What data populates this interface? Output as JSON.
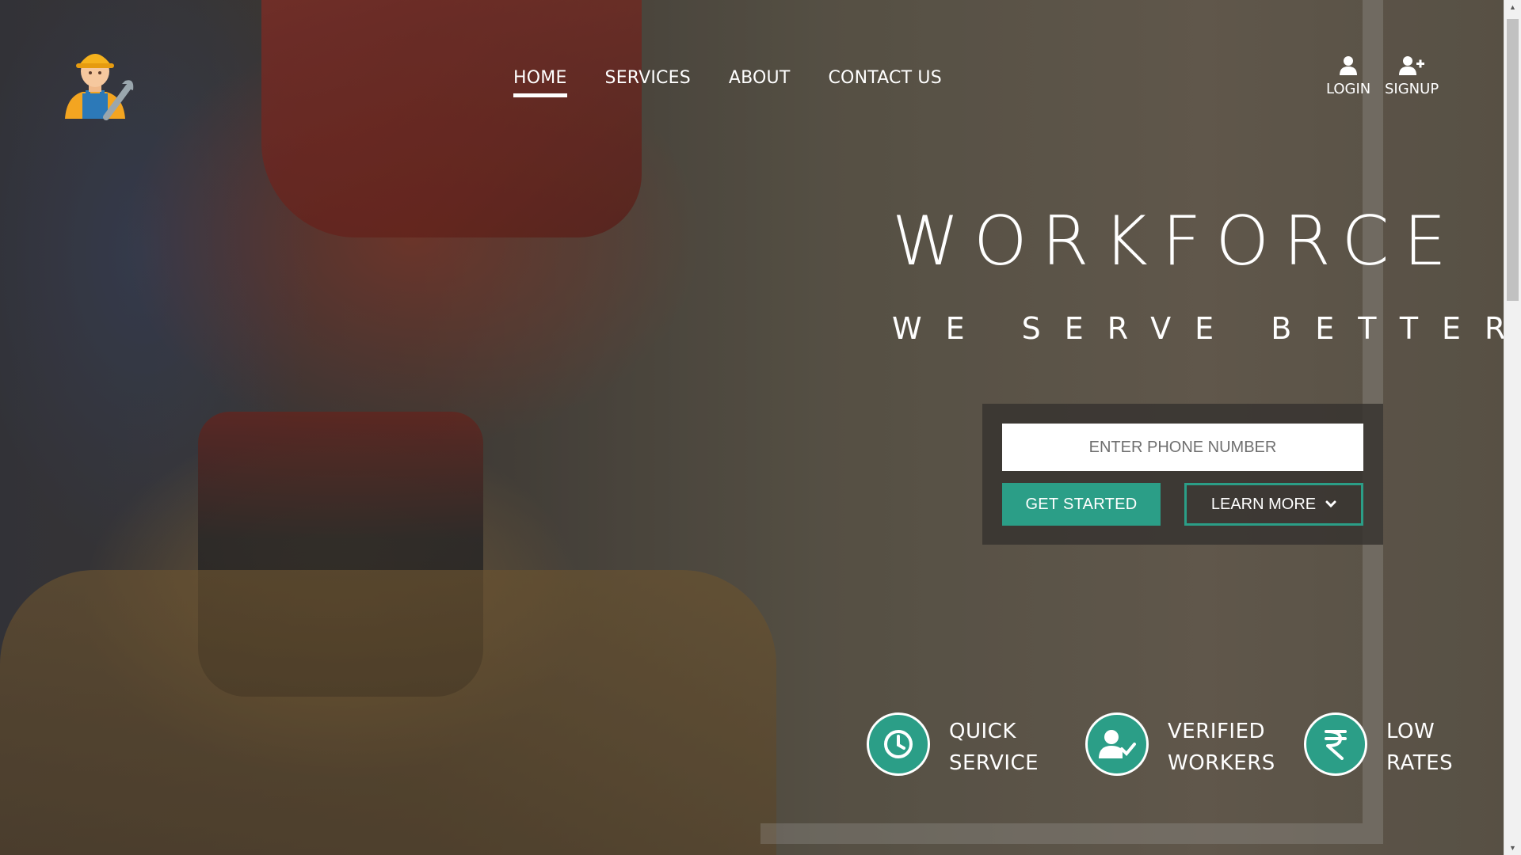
{
  "nav": {
    "items": [
      {
        "label": "HOME",
        "active": true
      },
      {
        "label": "SERVICES",
        "active": false
      },
      {
        "label": "ABOUT",
        "active": false
      },
      {
        "label": "CONTACT US",
        "active": false
      }
    ]
  },
  "auth": {
    "login_label": "LOGIN",
    "signup_label": "SIGNUP"
  },
  "hero": {
    "title": "WORKFORCE",
    "subtitle": "WE SERVE BETTER"
  },
  "cta": {
    "phone_placeholder": "ENTER PHONE NUMBER",
    "get_started_label": "GET STARTED",
    "learn_more_label": "LEARN MORE"
  },
  "features": [
    {
      "icon": "clock-icon",
      "line1": "QUICK",
      "line2": "SERVICE"
    },
    {
      "icon": "verified-user-icon",
      "line1": "VERIFIED",
      "line2": "WORKERS"
    },
    {
      "icon": "rupee-icon",
      "line1": "LOW",
      "line2": "RATES"
    }
  ],
  "colors": {
    "accent": "#2b9e87",
    "cta_box": "#37342f",
    "text": "#ffffff"
  }
}
